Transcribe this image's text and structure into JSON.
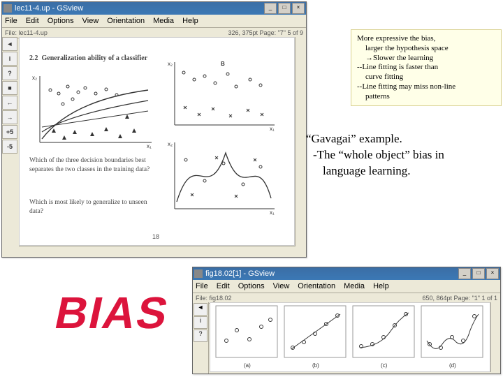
{
  "win1": {
    "title": "lec11-4.up - GSview",
    "menu": [
      "File",
      "Edit",
      "Options",
      "View",
      "Orientation",
      "Media",
      "Help"
    ],
    "tb_file": "File: lec11-4.up",
    "tb_page": "326, 375pt   Page: \"7\"  5 of 9",
    "doc": {
      "section_num": "2.2",
      "section_title": "Generalization ability of a classifier",
      "q1": "Which of the three decision boundaries best separates the two classes in the training data?",
      "q2": "Which is most likely to generalize to unseen data?",
      "pagenum": "18"
    }
  },
  "win2": {
    "title": "fig18.02[1] - GSview",
    "menu": [
      "File",
      "Edit",
      "Options",
      "View",
      "Orientation",
      "Media",
      "Help"
    ],
    "tb_file": "File: fig18.02",
    "tb_page": "650, 864pt   Page: \"1\"  1 of 1",
    "labels": [
      "(a)",
      "(b)",
      "(c)",
      "(d)"
    ]
  },
  "note": {
    "l1": "More expressive the bias,",
    "l2": "larger the hypothesis space",
    "l3": "→Slower the learning",
    "l4": "--Line fitting is faster than",
    "l5": "curve fitting",
    "l6": "--Line fitting may miss non-line",
    "l7": "patterns"
  },
  "gavagai": {
    "l1": "“Gavagai” example.",
    "l2": "-The “whole object” bias in",
    "l3": "language learning."
  },
  "bias_word": "BIAS",
  "icons": {
    "min": "_",
    "max": "□",
    "close": "×"
  },
  "side_icons": [
    "◄",
    "i",
    "?",
    "■",
    "←",
    "→",
    "+5",
    "-5"
  ]
}
